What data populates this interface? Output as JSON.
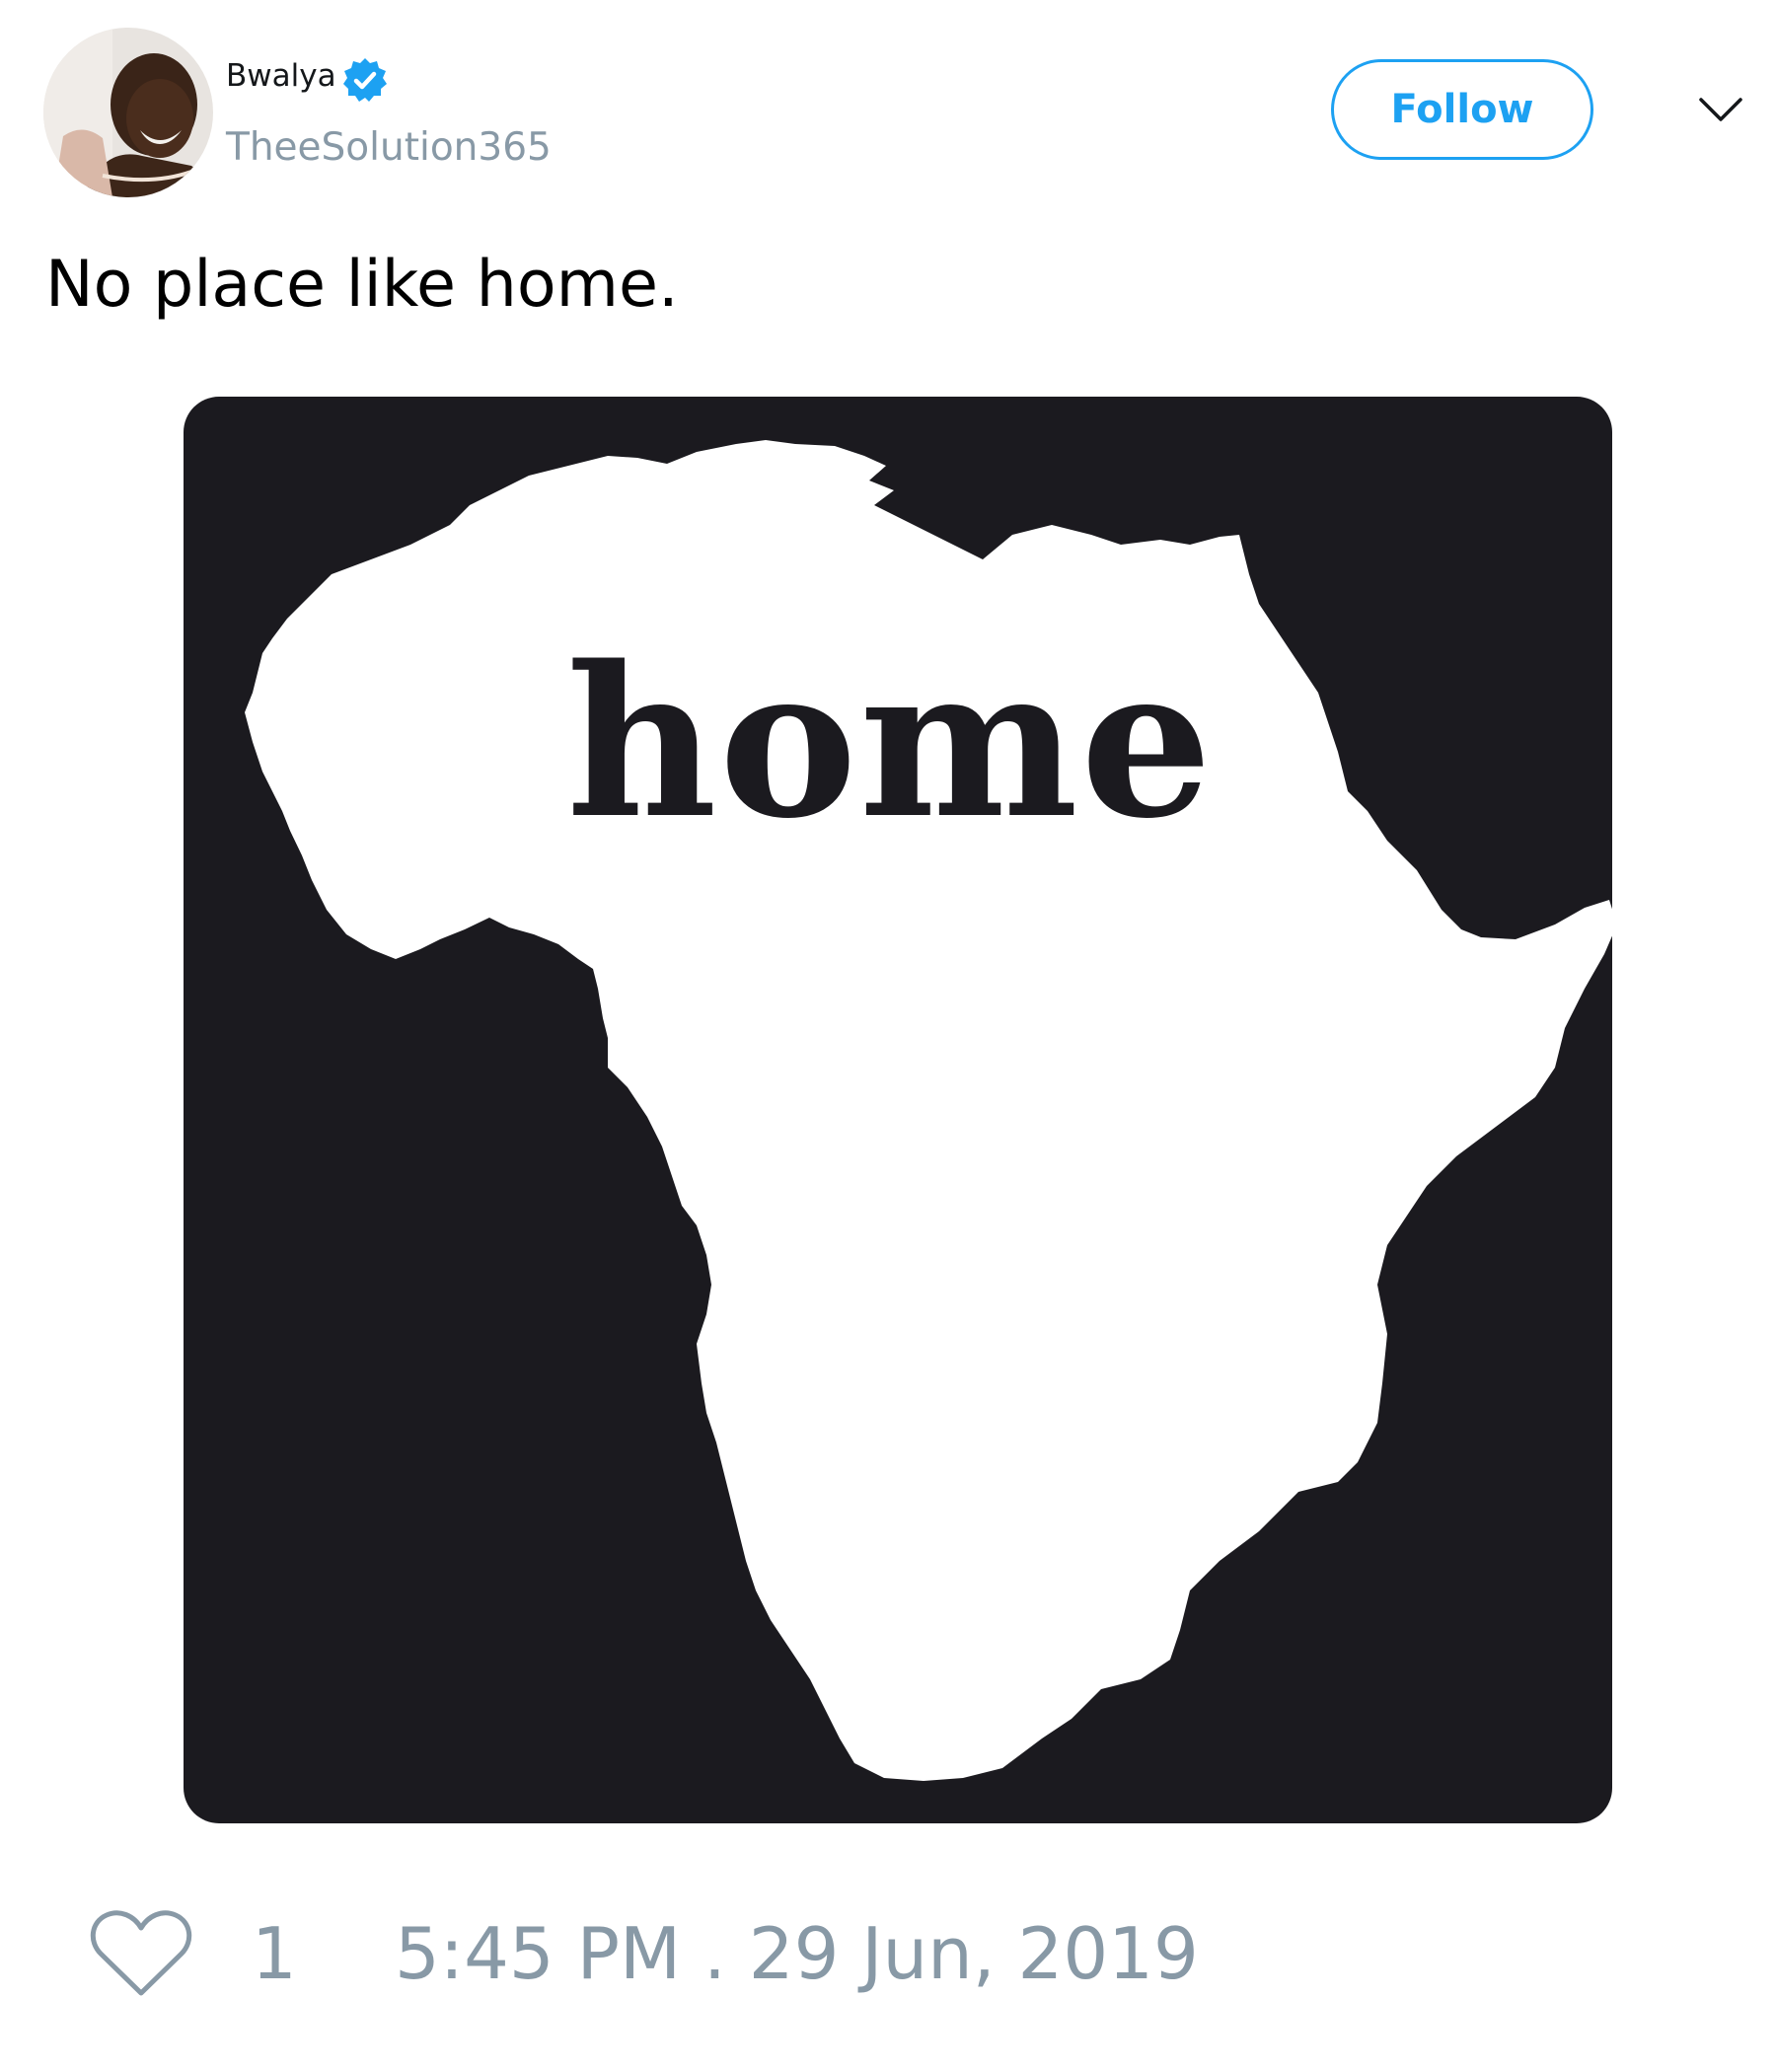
{
  "user": {
    "display_name": "Bwalya",
    "handle": "TheeSolution365",
    "verified": true,
    "avatar_icon": "profile-photo"
  },
  "header": {
    "follow_label": "Follow",
    "menu_icon": "chevron-down-icon"
  },
  "tweet": {
    "text": "No place like home."
  },
  "media": {
    "image_text": "home",
    "description_icon": "africa-silhouette"
  },
  "footer": {
    "like_icon": "heart-icon",
    "like_count": "1",
    "timestamp": "5:45 PM . 29 Jun, 2019"
  },
  "colors": {
    "accent": "#1da1f2",
    "muted": "#8899a6",
    "media_background": "#1b1a1f"
  }
}
